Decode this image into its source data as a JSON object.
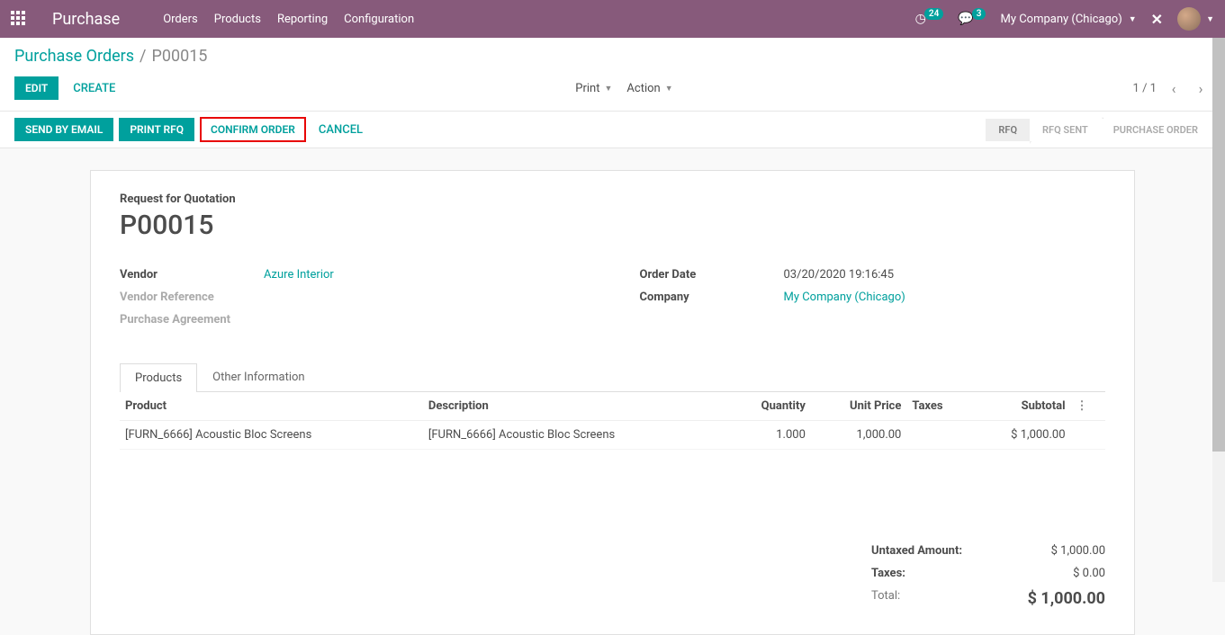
{
  "topbar": {
    "app_title": "Purchase",
    "menu": [
      "Orders",
      "Products",
      "Reporting",
      "Configuration"
    ],
    "activity_badge": "24",
    "chat_badge": "3",
    "company": "My Company (Chicago)"
  },
  "breadcrumb": {
    "parent": "Purchase Orders",
    "current": "P00015"
  },
  "controls": {
    "edit": "EDIT",
    "create": "CREATE",
    "print": "Print",
    "action": "Action",
    "pager": "1 / 1"
  },
  "actions": {
    "send_email": "SEND BY EMAIL",
    "print_rfq": "PRINT RFQ",
    "confirm": "CONFIRM ORDER",
    "cancel": "CANCEL"
  },
  "statusbar": {
    "rfq": "RFQ",
    "rfq_sent": "RFQ SENT",
    "po": "PURCHASE ORDER"
  },
  "form": {
    "title_label": "Request for Quotation",
    "name": "P00015",
    "labels": {
      "vendor": "Vendor",
      "vendor_ref": "Vendor Reference",
      "agreement": "Purchase Agreement",
      "order_date": "Order Date",
      "company": "Company"
    },
    "values": {
      "vendor": "Azure Interior",
      "order_date": "03/20/2020 19:16:45",
      "company": "My Company (Chicago)"
    }
  },
  "tabs": {
    "products": "Products",
    "other": "Other Information"
  },
  "table": {
    "headers": {
      "product": "Product",
      "description": "Description",
      "quantity": "Quantity",
      "unit_price": "Unit Price",
      "taxes": "Taxes",
      "subtotal": "Subtotal"
    },
    "rows": [
      {
        "product": "[FURN_6666] Acoustic Bloc Screens",
        "description": "[FURN_6666] Acoustic Bloc Screens",
        "quantity": "1.000",
        "unit_price": "1,000.00",
        "taxes": "",
        "subtotal": "$ 1,000.00"
      }
    ]
  },
  "totals": {
    "untaxed_label": "Untaxed Amount:",
    "untaxed_value": "$ 1,000.00",
    "taxes_label": "Taxes:",
    "taxes_value": "$ 0.00",
    "total_label": "Total:",
    "total_value": "$ 1,000.00"
  }
}
